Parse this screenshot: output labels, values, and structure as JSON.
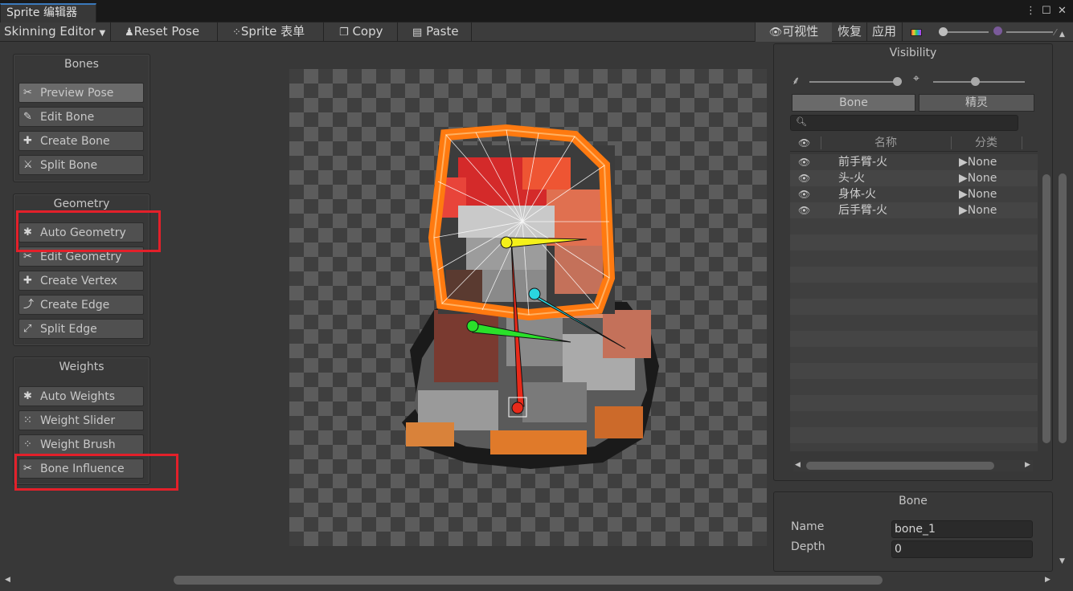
{
  "window": {
    "tab_title": "Sprite 编辑器"
  },
  "toolbar": {
    "mode": "Skinning Editor",
    "reset_pose": "Reset Pose",
    "sprite_sheet": "Sprite 表单",
    "copy": "Copy",
    "paste": "Paste",
    "visibility": "可视性",
    "revert": "恢复",
    "apply": "应用"
  },
  "bones_panel": {
    "title": "Bones",
    "tools": [
      "Preview Pose",
      "Edit Bone",
      "Create Bone",
      "Split Bone"
    ]
  },
  "geometry_panel": {
    "title": "Geometry",
    "tools": [
      "Auto Geometry",
      "Edit Geometry",
      "Create Vertex",
      "Create Edge",
      "Split Edge"
    ]
  },
  "weights_panel": {
    "title": "Weights",
    "tools": [
      "Auto Weights",
      "Weight Slider",
      "Weight Brush",
      "Bone Influence"
    ]
  },
  "visibility_panel": {
    "title": "Visibility",
    "tabs": [
      "Bone",
      "精灵"
    ],
    "columns": [
      "名称",
      "分类"
    ],
    "rows": [
      {
        "name": "前手臂-火",
        "category": "None"
      },
      {
        "name": "头-火",
        "category": "None"
      },
      {
        "name": "身体-火",
        "category": "None"
      },
      {
        "name": "后手臂-火",
        "category": "None"
      }
    ]
  },
  "bone_panel": {
    "title": "Bone",
    "name_label": "Name",
    "name_value": "bone_1",
    "depth_label": "Depth",
    "depth_value": "0"
  },
  "icons": [
    "menu-icon",
    "maximize-icon",
    "close-icon",
    "eye-icon",
    "color-swatch-icon",
    "search-icon",
    "brush-icon"
  ]
}
